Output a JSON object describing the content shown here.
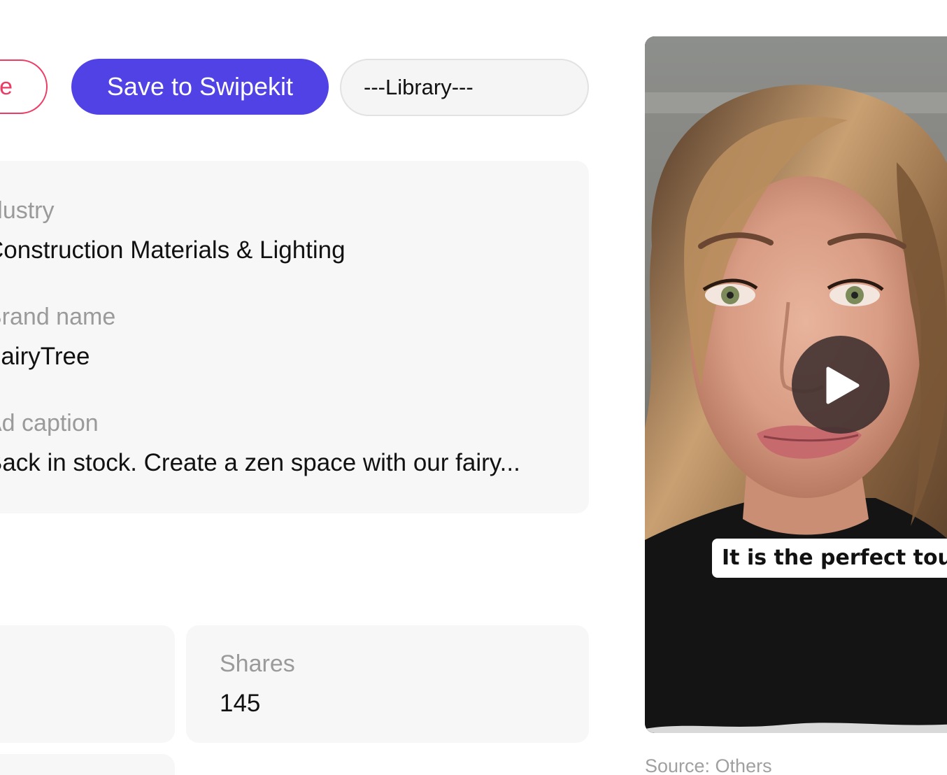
{
  "actions": {
    "partial_button_label": "e",
    "save_label": "Save to Swipekit",
    "library_select_value": "---Library---"
  },
  "details": {
    "industry_label": "ndustry",
    "industry_value": "Construction Materials & Lighting",
    "brand_label": "Brand name",
    "brand_value": "FairyTree",
    "caption_label": "Ad caption",
    "caption_value": "Back in stock. Create a zen space with our fairy..."
  },
  "stats": {
    "shares_label": "Shares",
    "shares_value": "145"
  },
  "video": {
    "subtitle": "It is the perfect touch",
    "play_icon": "play-icon"
  },
  "source": {
    "text": "Source: Others"
  },
  "colors": {
    "accent": "#5142e6",
    "danger": "#ee3b63"
  }
}
